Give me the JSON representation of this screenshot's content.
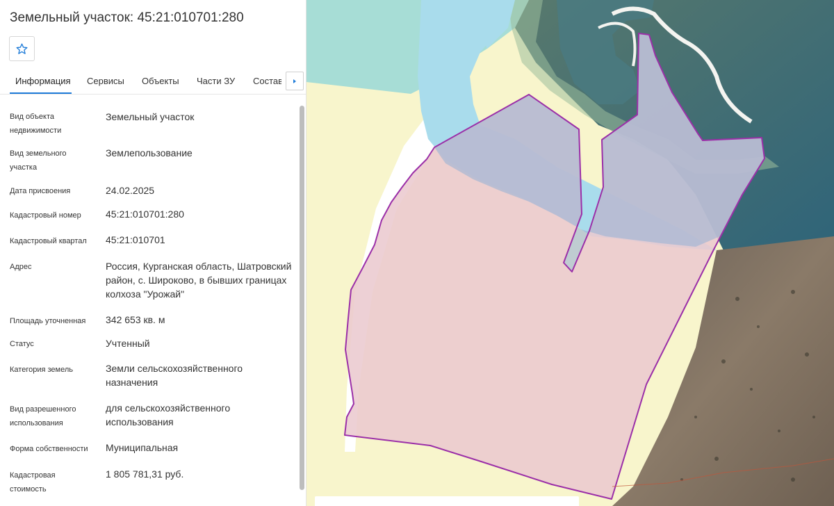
{
  "header": {
    "title": "Земельный участок: 45:21:010701:280"
  },
  "tabs": [
    {
      "label": "Информация",
      "active": true
    },
    {
      "label": "Сервисы",
      "active": false
    },
    {
      "label": "Объекты",
      "active": false
    },
    {
      "label": "Части ЗУ",
      "active": false
    },
    {
      "label": "Состав",
      "active": false
    }
  ],
  "info": [
    {
      "label": "Вид объекта недвижимости",
      "value": "Земельный участок"
    },
    {
      "label": "Вид земельного участка",
      "value": "Землепользование"
    },
    {
      "label": "Дата присвоения",
      "value": "24.02.2025"
    },
    {
      "label": "Кадастровый номер",
      "value": "45:21:010701:280"
    },
    {
      "label": "Кадастровый квартал",
      "value": "45:21:010701"
    },
    {
      "label": "Адрес",
      "value": "Россия, Курганская область, Шатровский район, с. Широково, в бывших границах колхоза \"Урожай\""
    },
    {
      "label": "Площадь уточненная",
      "value": "342 653 кв. м"
    },
    {
      "label": "Статус",
      "value": "Учтенный"
    },
    {
      "label": "Категория земель",
      "value": "Земли сельскохозяйственного назначения"
    },
    {
      "label": "Вид разрешенного использования",
      "value": "для сельскохозяйственного использования"
    },
    {
      "label": "Форма собственности",
      "value": "Муниципальная"
    },
    {
      "label": "Кадастровая стоимость",
      "value": "1 805 781,31 руб."
    }
  ],
  "icons": {
    "favorite": "star-outline-icon",
    "tab_scroll": "caret-right-icon"
  },
  "colors": {
    "accent": "#1e7bd8",
    "parcel_outline": "#9b2fa8",
    "parcel_fill": "#ebc9cf",
    "water_zone": "#a9dcec",
    "protection_zone": "#a7ddd6",
    "field_zone": "#f8f4c8"
  }
}
